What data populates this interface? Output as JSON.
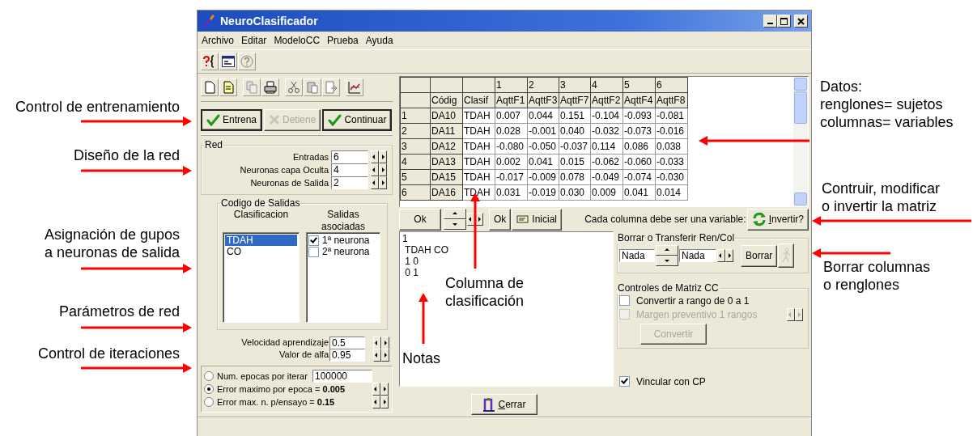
{
  "window": {
    "title": "NeuroClasificador"
  },
  "menu": [
    "Archivo",
    "Editar",
    "ModeloCC",
    "Prueba",
    "Ayuda"
  ],
  "training_buttons": [
    {
      "label": "Entrena",
      "disabled": false
    },
    {
      "label": "Detiene",
      "disabled": true
    },
    {
      "label": "Continuar",
      "disabled": false
    }
  ],
  "red": {
    "title": "Red",
    "fields": [
      {
        "label": "Entradas",
        "value": "6"
      },
      {
        "label": "Neuronas capa Oculta",
        "value": "4"
      },
      {
        "label": "Neuronas de Salida",
        "value": "2"
      }
    ]
  },
  "codigo_salidas": {
    "title": "Codigo de Salidas",
    "class_header": "Clasificacion",
    "outputs_header": "Salidas asociadas",
    "classes": [
      {
        "label": "TDAH",
        "selected": true
      },
      {
        "label": "CO",
        "selected": false
      }
    ],
    "outputs": [
      {
        "label": "1ª neurona",
        "checked": true
      },
      {
        "label": "2ª neurona",
        "checked": false
      }
    ]
  },
  "params": [
    {
      "label": "Velocidad aprendizaje",
      "value": "0.5"
    },
    {
      "label": "Valor de alfa",
      "value": "0.95"
    }
  ],
  "iterations": [
    {
      "kind": "field",
      "label": "Num. epocas por iterar",
      "value": "100000",
      "selected": false
    },
    {
      "kind": "spin",
      "label": "Error maximo por epoca = **0.005**",
      "selected": true
    },
    {
      "kind": "spin",
      "label": "Error max. n.  p/ensayo = **0.15**",
      "selected": false
    }
  ],
  "grid": {
    "number_row": [
      "1",
      "2",
      "3",
      "4",
      "5",
      "6"
    ],
    "columns": [
      "Códig",
      "Clasif",
      "AqttF1",
      "AqttF3",
      "AqttF7",
      "AqttF2",
      "AqttF4",
      "AqttF8"
    ],
    "rows": [
      {
        "number": "1",
        "cells": [
          "DA10",
          "TDAH",
          "0.007",
          "0.044",
          "0.151",
          "-0.104",
          "-0.093",
          "-0.081"
        ]
      },
      {
        "number": "2",
        "cells": [
          "DA11",
          "TDAH",
          "0.028",
          "-0.001",
          "0.040",
          "-0.032",
          "-0.073",
          "-0.016"
        ]
      },
      {
        "number": "3",
        "cells": [
          "DA12",
          "TDAH",
          "-0.080",
          "-0.050",
          "-0.037",
          "0.114",
          "0.086",
          "0.038"
        ]
      },
      {
        "number": "4",
        "cells": [
          "DA13",
          "TDAH",
          "0.002",
          "0.041",
          "0.015",
          "-0.062",
          "-0.060",
          "-0.033"
        ]
      },
      {
        "number": "5",
        "cells": [
          "DA15",
          "TDAH",
          "-0.017",
          "-0.009",
          "0.078",
          "-0.049",
          "-0.074",
          "-0.030"
        ]
      },
      {
        "number": "6",
        "cells": [
          "DA16",
          "TDAH",
          "0.031",
          "-0.019",
          "0.030",
          "0.009",
          "0.041",
          "0.014"
        ]
      }
    ]
  },
  "grid_toolbar": {
    "ok_buttons": [
      "Ok",
      "Ok"
    ],
    "reset_button": "Inicial",
    "hint": "Cada columna debe ser una variable:",
    "invert_button": "Invertir?"
  },
  "notes": "1\n TDAH CO\n 1 0\n 0 1",
  "borrar": {
    "title": "Borrar o Transferir Ren/Col",
    "fields": [
      "Nada",
      "Nada"
    ],
    "button": "Borrar",
    "figure_button": {
      "disabled": true
    }
  },
  "matriz": {
    "title": "Controles de Matriz CC",
    "options": [
      {
        "label": "Convertir a rango de 0 a 1",
        "checked": false,
        "disabled": false
      },
      {
        "label": "Margen preventivo 1 rangos",
        "checked": false,
        "disabled": true
      }
    ],
    "button": {
      "label": "Convertir",
      "disabled": true
    }
  },
  "vincular": {
    "label": "Vincular con CP",
    "checked": true
  },
  "close_button": "Cerrar",
  "annotations": [
    "Control de entrenamiento",
    "Datos:\nrenglones= sujetos\ncolumnas= variables",
    "Diseño de la red",
    "Contruir, modificar\no invertir la matriz",
    "Asignación de gupos\na neuronas de salida",
    "Borrar columnas\no renglones",
    "Columna de\nclasificación",
    "Parámetros de red",
    "Control de iteraciones",
    "Notas"
  ]
}
